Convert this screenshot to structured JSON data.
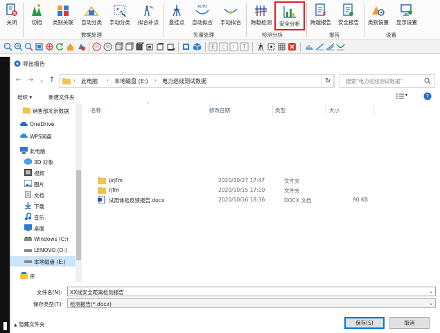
{
  "ribbon": {
    "buttons": [
      {
        "label": "关闭",
        "icon": "close-doc-icon"
      },
      {
        "label": "切档",
        "icon": "switch-icon"
      },
      {
        "label": "类别关联",
        "icon": "category-link-icon"
      },
      {
        "label": "自动分类",
        "icon": "auto-classify-icon"
      },
      {
        "label": "手动分类",
        "icon": "manual-classify-icon"
      },
      {
        "label": "拟合补点",
        "icon": "fit-point-icon"
      },
      {
        "label": "悬挂点",
        "icon": "hang-point-icon"
      },
      {
        "label": "自动拟合",
        "icon": "auto-fit-icon"
      },
      {
        "label": "手动拟合",
        "icon": "manual-fit-icon"
      },
      {
        "label": "跨越检测",
        "icon": "crossing-detect-icon"
      },
      {
        "label": "安全分析",
        "icon": "safety-analysis-icon"
      },
      {
        "label": "跨越报告",
        "icon": "crossing-report-icon"
      },
      {
        "label": "安全报告",
        "icon": "safety-report-icon"
      },
      {
        "label": "类别设置",
        "icon": "category-settings-icon"
      },
      {
        "label": "显示设置",
        "icon": "display-settings-icon"
      }
    ],
    "groups": [
      "数据处理",
      "矢量处理",
      "检测分析",
      "报告",
      "设置"
    ],
    "auto_badge": "AUTO"
  },
  "dialog": {
    "title": "导出报告",
    "address": [
      "此电脑",
      "本地磁盘 (E:)",
      "电力巡线测试数据"
    ],
    "search_placeholder": "搜索\"电力巡线测试数据\"",
    "organize": "组织 ▾",
    "new_folder": "新建文件夹",
    "nav_items": [
      {
        "label": "销售部北京数据",
        "icon": "folder-icon"
      },
      {
        "label": "OneDrive",
        "icon": "cloud-icon"
      },
      {
        "label": "WPS网盘",
        "icon": "wps-cloud-icon"
      },
      {
        "label": "此电脑",
        "icon": "computer-icon"
      },
      {
        "label": "3D 对象",
        "icon": "3d-objects-icon"
      },
      {
        "label": "视频",
        "icon": "video-icon"
      },
      {
        "label": "图片",
        "icon": "picture-icon"
      },
      {
        "label": "文档",
        "icon": "document-icon"
      },
      {
        "label": "下载",
        "icon": "download-icon"
      },
      {
        "label": "音乐",
        "icon": "music-icon"
      },
      {
        "label": "桌面",
        "icon": "desktop-icon"
      },
      {
        "label": "Windows (C:)",
        "icon": "drive-icon"
      },
      {
        "label": "LENOVO (D:)",
        "icon": "drive-icon"
      },
      {
        "label": "本地磁盘 (E:)",
        "icon": "drive-icon"
      },
      {
        "label": "库",
        "icon": "library-icon"
      }
    ],
    "columns": [
      "名称",
      "修改日期",
      "类型",
      "大小"
    ],
    "files": [
      {
        "name": "prjfm",
        "date": "2020/10/27 17:47",
        "type": "文件夹",
        "size": "",
        "icon": "folder-icon"
      },
      {
        "name": "rjfm",
        "date": "2020/10/15 17:10",
        "type": "文件夹",
        "size": "",
        "icon": "folder-icon"
      },
      {
        "name": "试用体验反馈报告.docx",
        "date": "2020/10/16 18:36",
        "type": "DOCX 文档",
        "size": "90 KB",
        "icon": "docx-icon"
      }
    ],
    "filename_label": "文件名(N):",
    "filename_value": "XX线安全距离检测报告",
    "filetype_label": "保存类型(T):",
    "filetype_value": "检测报告(*.docx)",
    "hide_folders": "隐藏文件夹",
    "save": "保存(S)",
    "cancel": "取消"
  },
  "colors": {
    "highlight_border": "#e02020",
    "accent": "#0078d7",
    "selection": "#cce4f7"
  }
}
